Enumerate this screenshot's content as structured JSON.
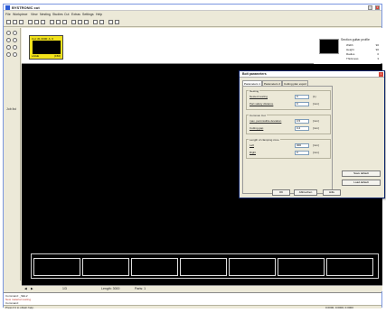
{
  "app": {
    "title": "BYSTRONIC cut",
    "menu": [
      "File",
      "Workpiece",
      "View",
      "Nesting",
      "Studies",
      "Cut",
      "Extras",
      "Settings",
      "Help"
    ]
  },
  "part_thumb": {
    "title": "Cut: #1 0000: A: 0",
    "left_label": "LAGE",
    "right_label": "(150)"
  },
  "guitar_profile": {
    "title": "Section guitar profile",
    "rows": [
      {
        "label": "Width",
        "value": "90"
      },
      {
        "label": "Height",
        "value": "90"
      },
      {
        "label": "Radius",
        "value": "0"
      },
      {
        "label": "Thickness",
        "value": "3"
      }
    ]
  },
  "side_label": "Job list",
  "dialog": {
    "title": "Bolt parameters",
    "tabs": [
      "Parameters 1",
      "Parameters 2",
      "Cutting plan export"
    ],
    "groups": [
      {
        "title": "Nesting",
        "fields": [
          {
            "label": "Nested nesting",
            "value": "0",
            "unit": "(1)"
          },
          {
            "label": "Part safety distance",
            "value": "0",
            "unit": "[mm]"
          }
        ]
      },
      {
        "title": "Common Cut",
        "fields": [
          {
            "label": "max. permissible deviation",
            "value": "0.5",
            "unit": "[mm]"
          },
          {
            "label": "Cutting gap",
            "value": "0.2",
            "unit": "[mm]"
          }
        ]
      },
      {
        "title": "Length of clamping zone",
        "fields": [
          {
            "label": "Left",
            "value": "300",
            "unit": "[mm]"
          },
          {
            "label": "Right",
            "value": "0",
            "unit": "[mm]"
          }
        ]
      }
    ],
    "side_buttons": [
      "Save default",
      "Load default"
    ],
    "buttons": [
      "OK",
      "Abbrechen",
      "Hilfe"
    ]
  },
  "statusrow": {
    "page": "1/3",
    "length_label": "Length: 3000",
    "parts_label": "Parts: 1"
  },
  "console": {
    "lines": [
      "Command: _SEL2",
      "New material nesting",
      "Command:"
    ]
  },
  "statusbar": {
    "left": "Press F1 to obtain help.",
    "right": "0.0000, 0.0000, 0.0000"
  }
}
